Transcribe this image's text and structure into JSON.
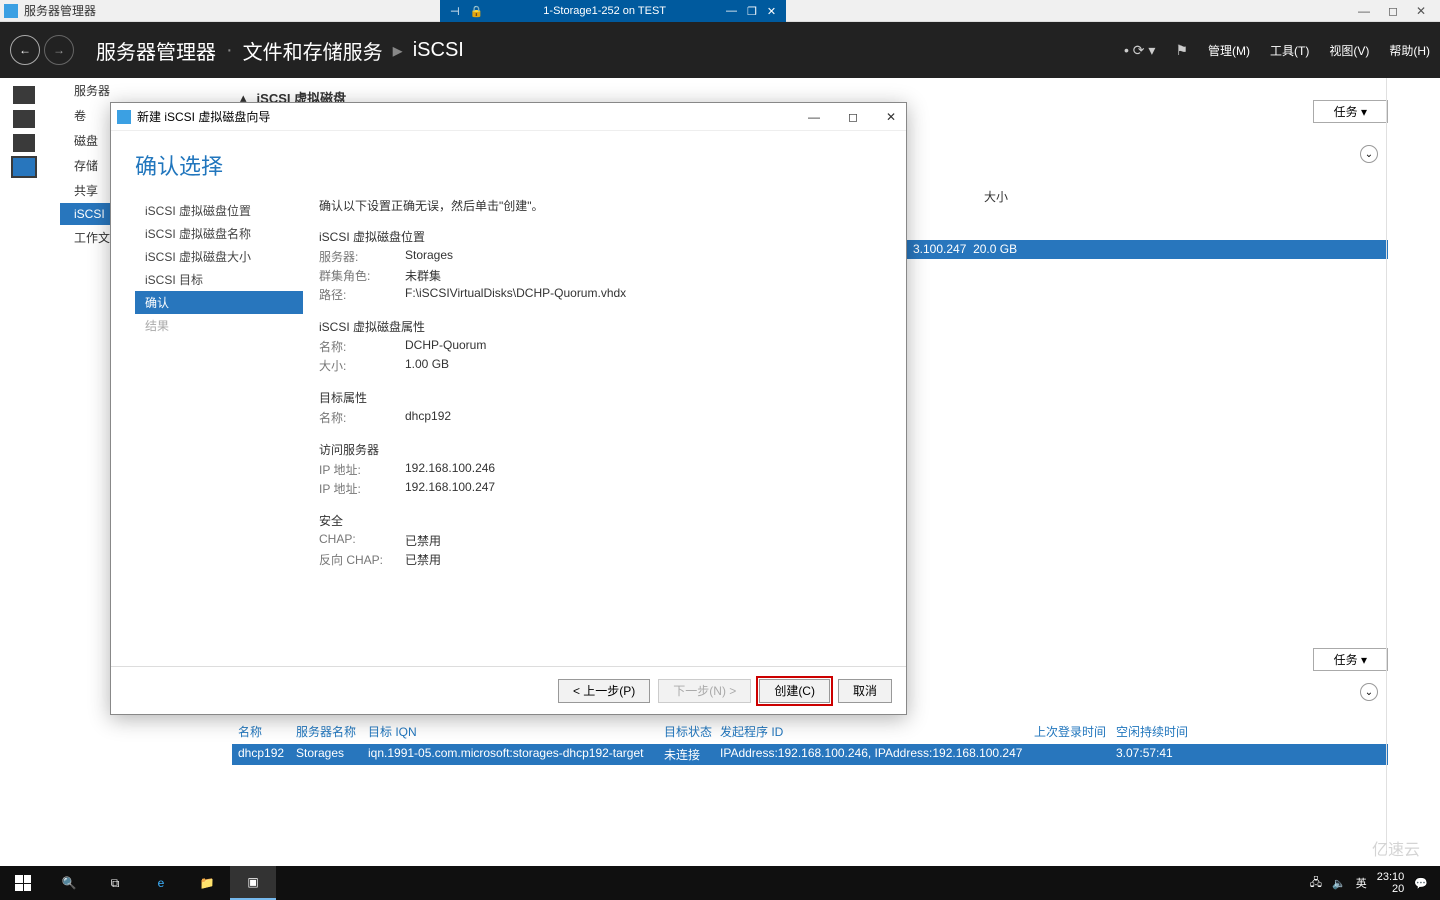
{
  "outer_window": {
    "title": "服务器管理器"
  },
  "remote_tab": {
    "label": "1-Storage1-252 on TEST"
  },
  "header": {
    "breadcrumb": [
      "服务器管理器",
      "文件和存储服务",
      "iSCSI"
    ],
    "menu": {
      "manage": "管理(M)",
      "tools": "工具(T)",
      "view": "视图(V)",
      "help": "帮助(H)"
    }
  },
  "server_list": {
    "items": [
      "服务器",
      "卷",
      "磁盘",
      "存储",
      "共享",
      "iSCSI",
      "工作文"
    ],
    "selected": "iSCSI"
  },
  "main_frag": {
    "heading": "iSCSI 虚拟磁盘",
    "tasks": "任务",
    "size_hdr": "大小"
  },
  "peek_row": {
    "ip": "3.100.247",
    "size": "20.0 GB"
  },
  "targets": {
    "header": {
      "name": "名称",
      "server": "服务器名称",
      "iqn": "目标 IQN",
      "status": "目标状态",
      "initiator": "发起程序 ID",
      "last": "上次登录时间",
      "idle": "空闲持续时间"
    },
    "row": {
      "name": "dhcp192",
      "server": "Storages",
      "iqn": "iqn.1991-05.com.microsoft:storages-dhcp192-target",
      "status": "未连接",
      "initiator": "IPAddress:192.168.100.246, IPAddress:192.168.100.247",
      "last": "",
      "idle": "3.07:57:41"
    }
  },
  "wizard": {
    "title": "新建 iSCSI 虚拟磁盘向导",
    "heading": "确认选择",
    "nav": [
      "iSCSI 虚拟磁盘位置",
      "iSCSI 虚拟磁盘名称",
      "iSCSI 虚拟磁盘大小",
      "iSCSI 目标",
      "确认",
      "结果"
    ],
    "nav_selected": 4,
    "instruction": "确认以下设置正确无误，然后单击\"创建\"。",
    "sections": {
      "loc": {
        "title": "iSCSI 虚拟磁盘位置",
        "server_k": "服务器:",
        "server_v": "Storages",
        "role_k": "群集角色:",
        "role_v": "未群集",
        "path_k": "路径:",
        "path_v": "F:\\iSCSIVirtualDisks\\DCHP-Quorum.vhdx"
      },
      "attr": {
        "title": "iSCSI 虚拟磁盘属性",
        "name_k": "名称:",
        "name_v": "DCHP-Quorum",
        "size_k": "大小:",
        "size_v": "1.00 GB"
      },
      "tgt": {
        "title": "目标属性",
        "name_k": "名称:",
        "name_v": "dhcp192"
      },
      "acc": {
        "title": "访问服务器",
        "ip_k": "IP 地址:",
        "ip1": "192.168.100.246",
        "ip2": "192.168.100.247"
      },
      "sec": {
        "title": "安全",
        "chap_k": "CHAP:",
        "chap_v": "已禁用",
        "rchap_k": "反向 CHAP:",
        "rchap_v": "已禁用"
      }
    },
    "buttons": {
      "prev": "< 上一步(P)",
      "next": "下一步(N) >",
      "create": "创建(C)",
      "cancel": "取消"
    }
  },
  "taskbar": {
    "ime": "英",
    "date": "20",
    "time": "23:10"
  },
  "watermark": "亿速云"
}
